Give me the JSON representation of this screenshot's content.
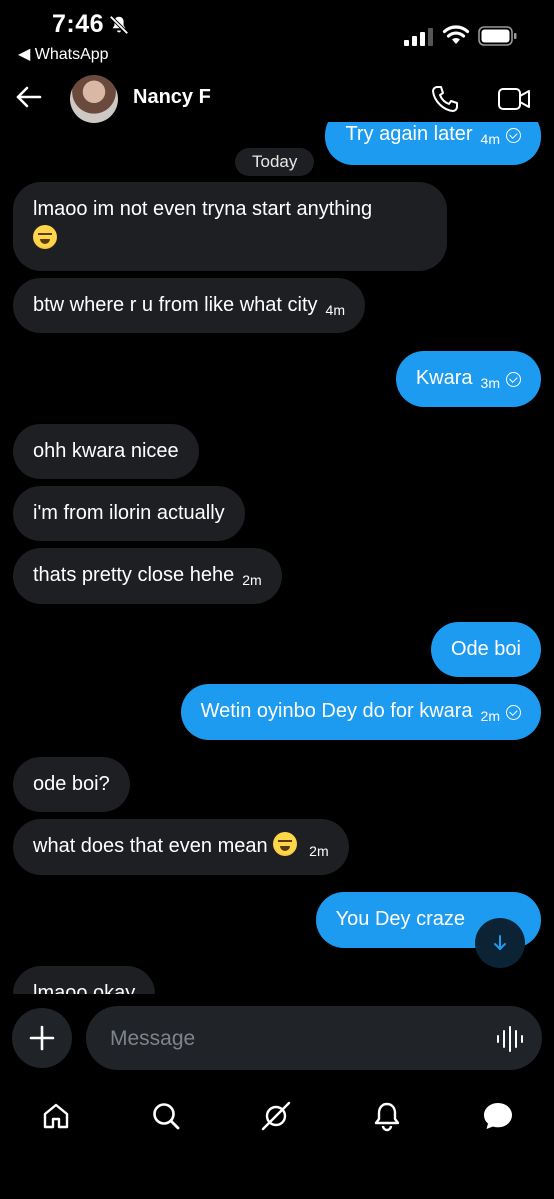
{
  "status_bar": {
    "time": "7:46",
    "back_app": "◀ WhatsApp"
  },
  "header": {
    "contact_name": "Nancy F"
  },
  "chat": {
    "date_separator": "Today",
    "messages": [
      {
        "dir": "out",
        "text": "Try again later",
        "time": "4m",
        "read": true
      },
      {
        "dir": "in",
        "text": "lmaoo im not even tryna start anything",
        "emoji": "loudly-crying-face"
      },
      {
        "dir": "in",
        "text": "btw where r u from like what city",
        "time": "4m"
      },
      {
        "dir": "out",
        "text": "Kwara",
        "time": "3m",
        "read": true
      },
      {
        "dir": "in",
        "text": "ohh kwara nicee"
      },
      {
        "dir": "in",
        "text": "i'm from ilorin actually"
      },
      {
        "dir": "in",
        "text": "thats pretty close hehe",
        "time": "2m"
      },
      {
        "dir": "out",
        "text": "Ode boi"
      },
      {
        "dir": "out",
        "text": "Wetin oyinbo Dey do for kwara",
        "time": "2m",
        "read": true
      },
      {
        "dir": "in",
        "text": "ode boi?"
      },
      {
        "dir": "in",
        "text": "what does that even mean",
        "emoji": "face-with-tears-of-joy",
        "time": "2m"
      },
      {
        "dir": "out",
        "text": "You Dey craze"
      },
      {
        "dir": "in",
        "text": "lmaoo okay"
      }
    ]
  },
  "composer": {
    "placeholder": "Message"
  },
  "colors": {
    "outgoing_bubble": "#1d9bf0",
    "incoming_bubble": "#1e1f22",
    "background": "#000000"
  },
  "icons": [
    "back-arrow-icon",
    "phone-icon",
    "video-icon",
    "plus-icon",
    "voice-wave-icon",
    "home-icon",
    "search-icon",
    "grok-icon",
    "bell-icon",
    "messages-icon",
    "arrow-down-icon"
  ]
}
